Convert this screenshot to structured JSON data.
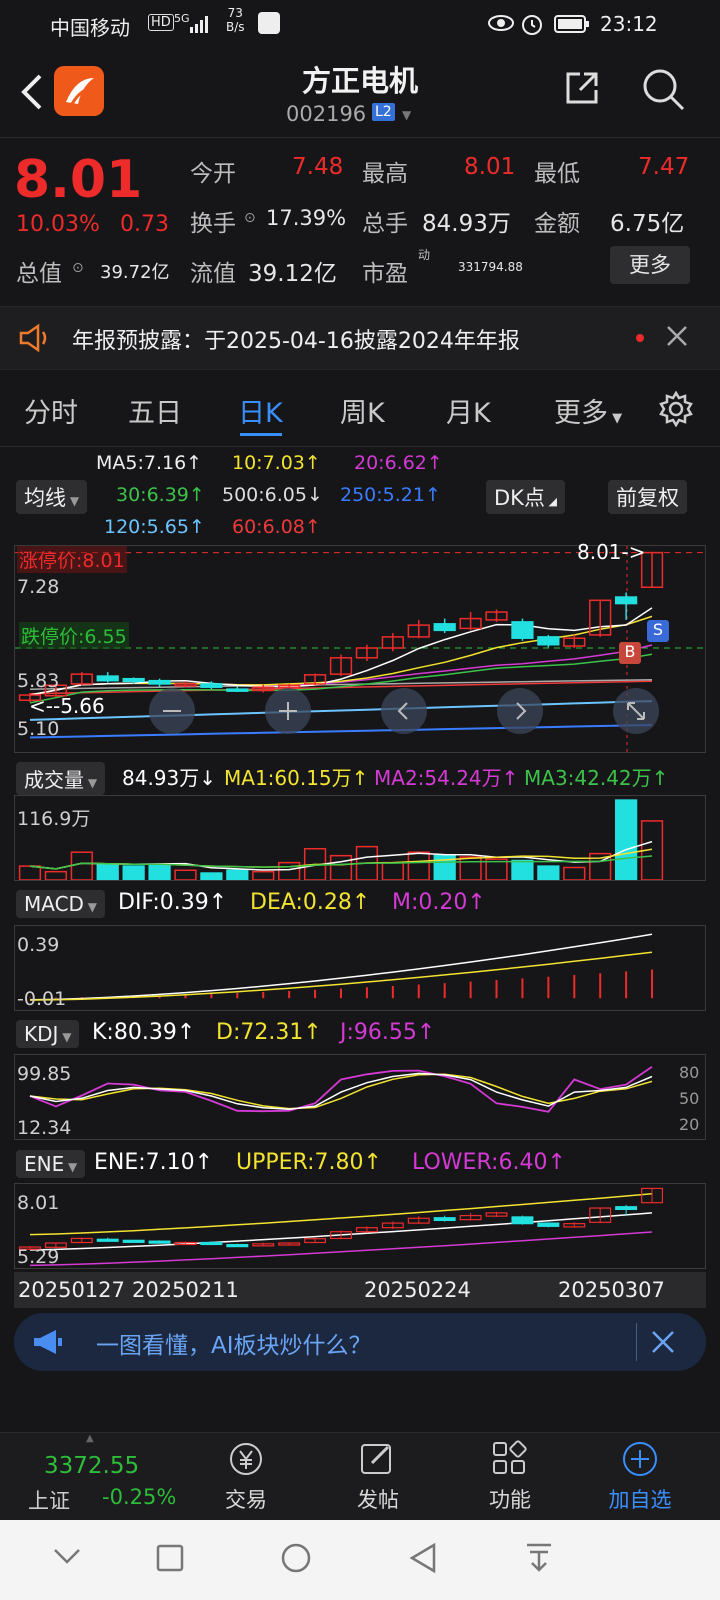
{
  "status": {
    "carrier": "中国移动",
    "hd": "HD",
    "net_type": "5G",
    "net_speed": "73",
    "net_unit": "B/s",
    "time": "23:12"
  },
  "header": {
    "title": "方正电机",
    "code": "002196",
    "level_badge": "L2"
  },
  "quote": {
    "price": "8.01",
    "change_pct": "10.03%",
    "change_amt": "0.73",
    "open_label": "今开",
    "open": "7.48",
    "high_label": "最高",
    "high": "8.01",
    "low_label": "最低",
    "low": "7.47",
    "turnover_label": "换手",
    "turnover": "17.39%",
    "volume_label": "总手",
    "volume": "84.93万",
    "amount_label": "金额",
    "amount": "6.75亿",
    "mktcap_label": "总值",
    "mktcap": "39.72亿",
    "float_label": "流值",
    "float": "39.12亿",
    "pe_label": "市盈",
    "pe_sup": "动",
    "pe": "331794.88",
    "more_button": "更多"
  },
  "notice": {
    "text": "年报预披露：于2025-04-16披露2024年年报"
  },
  "tabs": [
    "分时",
    "五日",
    "日K",
    "周K",
    "月K",
    "更多"
  ],
  "active_tab": "日K",
  "ma_panel": {
    "selector": "均线",
    "dk_button": "DK点",
    "fq_button": "前复权",
    "ma5": "MA5:7.16↑",
    "ma10": "10:7.03↑",
    "ma20": "20:6.62↑",
    "ma30": "30:6.39↑",
    "ma500": "500:6.05↓",
    "ma250": "250:5.21↑",
    "ma120": "120:5.65↑",
    "ma60": "60:6.08↑"
  },
  "kchart": {
    "limit_up_label": "涨停价:8.01",
    "limit_down_label": "跌停价:6.55",
    "axis_top": "8.01",
    "axis_mid": "7.28",
    "axis_655": "6.55",
    "axis_583": "5.83",
    "axis_bottom": "5.10",
    "high_marker": "8.01->",
    "low_marker": "<--5.66",
    "sell_marker": "S",
    "buy_marker": "B",
    "candles": [
      {
        "o": 5.75,
        "c": 5.83,
        "h": 5.86,
        "l": 5.72
      },
      {
        "o": 5.82,
        "c": 5.98,
        "h": 6.0,
        "l": 5.8
      },
      {
        "o": 6.0,
        "c": 6.15,
        "h": 6.18,
        "l": 5.98
      },
      {
        "o": 6.12,
        "c": 6.05,
        "h": 6.18,
        "l": 6.02
      },
      {
        "o": 6.08,
        "c": 6.04,
        "h": 6.1,
        "l": 6.0
      },
      {
        "o": 6.05,
        "c": 6.0,
        "h": 6.08,
        "l": 5.96
      },
      {
        "o": 5.98,
        "c": 6.0,
        "h": 6.04,
        "l": 5.95
      },
      {
        "o": 6.0,
        "c": 5.95,
        "h": 6.04,
        "l": 5.92
      },
      {
        "o": 5.92,
        "c": 5.9,
        "h": 5.96,
        "l": 5.88
      },
      {
        "o": 5.9,
        "c": 5.95,
        "h": 5.99,
        "l": 5.87
      },
      {
        "o": 5.96,
        "c": 5.98,
        "h": 6.0,
        "l": 5.92
      },
      {
        "o": 6.0,
        "c": 6.14,
        "h": 6.16,
        "l": 5.98
      },
      {
        "o": 6.15,
        "c": 6.4,
        "h": 6.45,
        "l": 6.12
      },
      {
        "o": 6.4,
        "c": 6.55,
        "h": 6.6,
        "l": 6.35
      },
      {
        "o": 6.55,
        "c": 6.72,
        "h": 6.78,
        "l": 6.5
      },
      {
        "o": 6.72,
        "c": 6.9,
        "h": 6.98,
        "l": 6.7
      },
      {
        "o": 6.92,
        "c": 6.82,
        "h": 7.0,
        "l": 6.78
      },
      {
        "o": 6.85,
        "c": 7.0,
        "h": 7.1,
        "l": 6.82
      },
      {
        "o": 6.98,
        "c": 7.1,
        "h": 7.14,
        "l": 6.95
      },
      {
        "o": 6.95,
        "c": 6.7,
        "h": 7.0,
        "l": 6.66
      },
      {
        "o": 6.72,
        "c": 6.6,
        "h": 6.75,
        "l": 6.56
      },
      {
        "o": 6.58,
        "c": 6.7,
        "h": 6.75,
        "l": 6.55
      },
      {
        "o": 6.75,
        "c": 7.28,
        "h": 7.28,
        "l": 6.72
      },
      {
        "o": 7.33,
        "c": 7.23,
        "h": 7.4,
        "l": 6.98
      },
      {
        "o": 7.48,
        "c": 8.01,
        "h": 8.01,
        "l": 7.47
      }
    ]
  },
  "volume_panel": {
    "selector": "成交量",
    "vol": "84.93万↓",
    "ma1": "MA1:60.15万↑",
    "ma2": "MA2:54.24万↑",
    "ma3": "MA3:42.42万↑",
    "axis_top": "116.9万",
    "values": [
      20,
      12,
      40,
      22,
      20,
      22,
      14,
      10,
      14,
      12,
      25,
      45,
      35,
      48,
      25,
      40,
      35,
      33,
      30,
      28,
      20,
      18,
      38,
      115,
      85
    ]
  },
  "macd_panel": {
    "selector": "MACD",
    "dif": "DIF:0.39↑",
    "dea": "DEA:0.28↑",
    "m": "M:0.20↑",
    "axis_top": "0.39",
    "axis_bottom": "-0.01"
  },
  "kdj_panel": {
    "selector": "KDJ",
    "k": "K:80.39↑",
    "d": "D:72.31↑",
    "j": "J:96.55↑",
    "axis_top": "99.85",
    "axis_bottom": "12.34",
    "r80": "80",
    "r50": "50",
    "r20": "20"
  },
  "ene_panel": {
    "selector": "ENE",
    "ene": "ENE:7.10↑",
    "upper": "UPPER:7.80↑",
    "lower": "LOWER:6.40↑",
    "axis_top": "8.01",
    "axis_bottom": "5.29"
  },
  "dates": [
    "20250127",
    "20250211",
    "20250224",
    "20250307"
  ],
  "ad": {
    "text": "一图看懂，AI板块炒什么？"
  },
  "toolbar": {
    "index_value": "3372.55",
    "index_name": "上证",
    "index_change": "-0.25%",
    "trade": "交易",
    "post": "发帖",
    "function": "功能",
    "add_watch": "加自选"
  },
  "colors": {
    "up": "#ee2b2b",
    "down": "#22e0e0",
    "accent": "#3a8fff",
    "background": "#161618"
  }
}
